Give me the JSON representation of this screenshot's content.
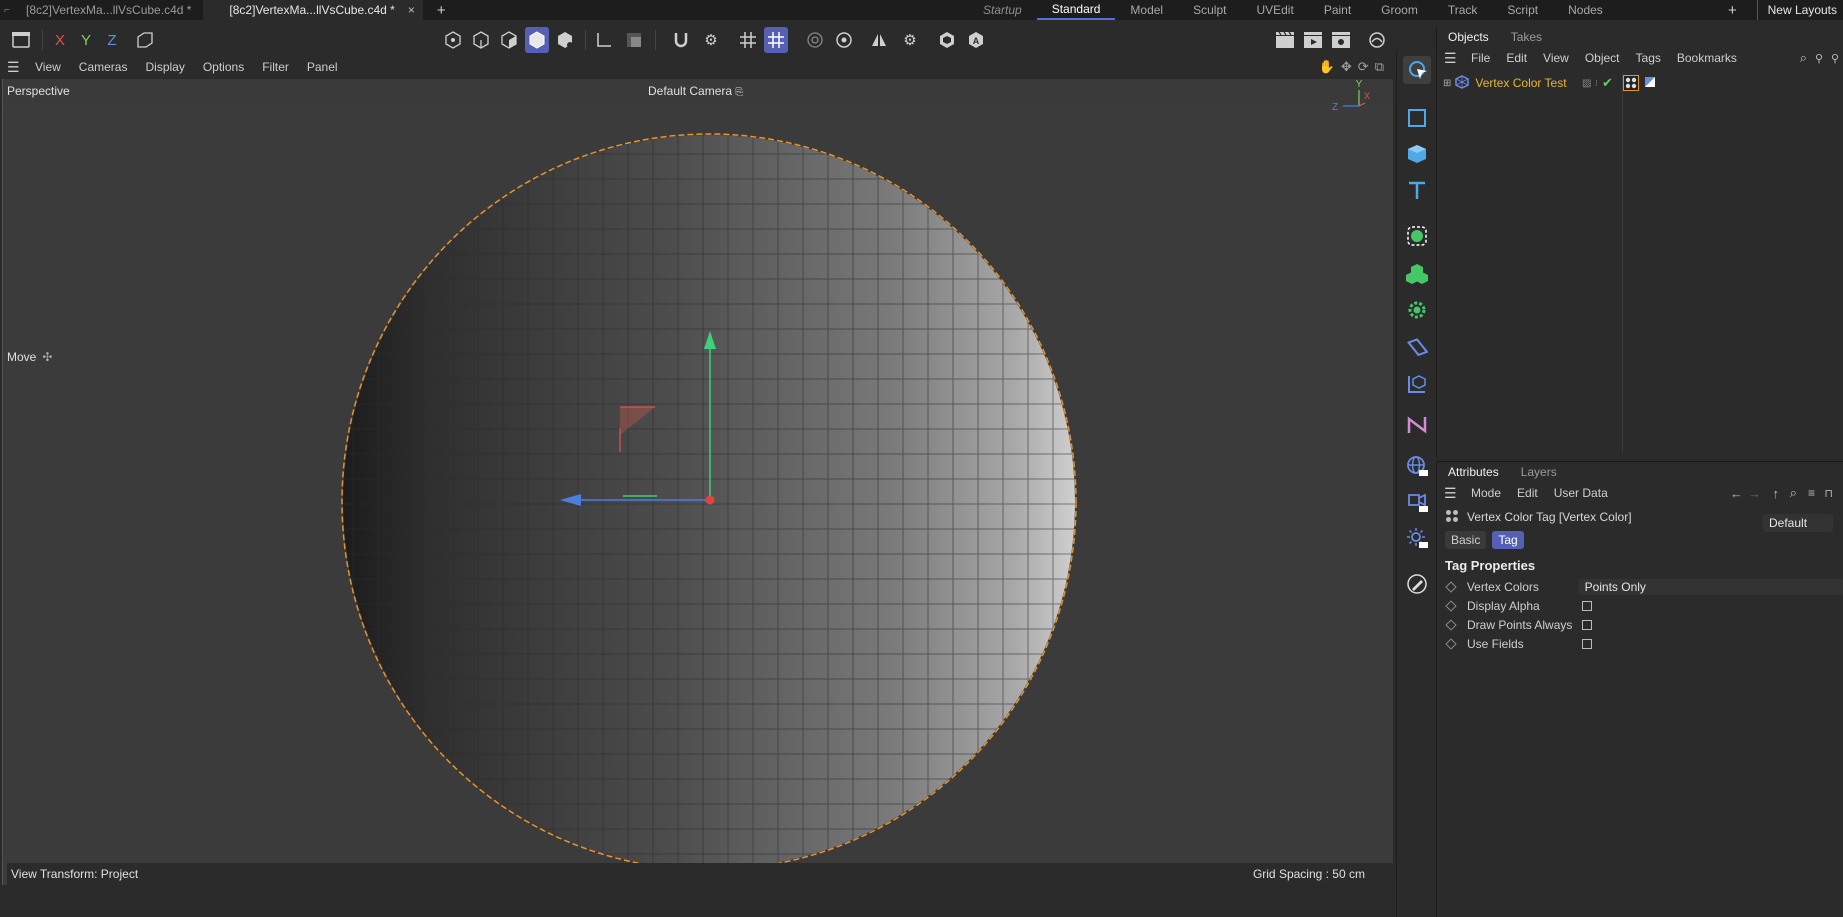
{
  "tabs": {
    "doc1": "[8c2]VertexMa...llVsCube.c4d *",
    "doc2": "[8c2]VertexMa...llVsCube.c4d *",
    "close": "×",
    "plus": "+"
  },
  "layouts": {
    "items": [
      "Startup",
      "Standard",
      "Model",
      "Sculpt",
      "UVEdit",
      "Paint",
      "Groom",
      "Track",
      "Script",
      "Nodes"
    ],
    "plus": "+",
    "new_layouts": "New Layouts"
  },
  "toolbar": {
    "x": "X",
    "y": "Y",
    "z": "Z"
  },
  "viewport_menu": {
    "items": [
      "View",
      "Cameras",
      "Display",
      "Options",
      "Filter",
      "Panel"
    ]
  },
  "viewport": {
    "label": "Perspective",
    "camera": "Default Camera",
    "move_label": "Move",
    "transform": "View Transform: Project",
    "grid": "Grid Spacing : 50 cm",
    "axis_y": "Y",
    "axis_z": "Z",
    "axis_x": "X",
    "colors": {
      "selection_outline": "#e8922a",
      "gizmo_y": "#3fd07a",
      "gizmo_x": "#d8584e",
      "gizmo_z": "#4a7fe0"
    }
  },
  "objects_panel": {
    "tabs": [
      "Objects",
      "Takes"
    ],
    "menu": [
      "File",
      "Edit",
      "View",
      "Object",
      "Tags",
      "Bookmarks"
    ],
    "object_name": "Vertex Color Test"
  },
  "attributes_panel": {
    "tabs": [
      "Attributes",
      "Layers"
    ],
    "menu": [
      "Mode",
      "Edit",
      "User Data"
    ],
    "title": "Vertex Color Tag [Vertex Color]",
    "preset": "Default",
    "subtabs": [
      "Basic",
      "Tag"
    ],
    "section": "Tag Properties",
    "props": [
      {
        "label": "Vertex Colors",
        "value": "Points Only"
      },
      {
        "label": "Display Alpha"
      },
      {
        "label": "Draw Points Always"
      },
      {
        "label": "Use Fields"
      }
    ]
  },
  "colors": {
    "accent": "#5560b5",
    "object_name": "#e8b730"
  }
}
